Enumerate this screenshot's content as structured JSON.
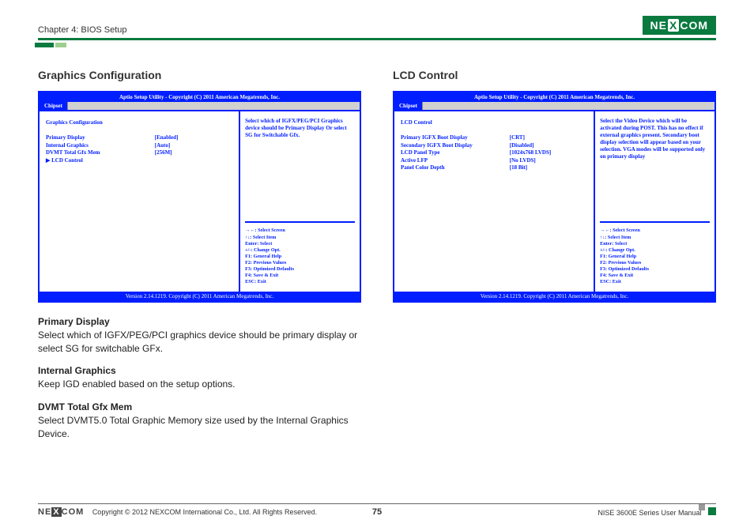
{
  "header": {
    "chapter": "Chapter 4: BIOS Setup",
    "brand": "NEXCOM"
  },
  "left": {
    "title": "Graphics Configuration",
    "bios": {
      "top": "Aptio Setup Utility - Copyright (C) 2011 American Megatrends, Inc.",
      "tab": "Chipset",
      "heading": "Graphics Configuration",
      "rows": [
        {
          "label": "Primary Display",
          "value": "[Enabled]"
        },
        {
          "label": "Internal Graphics",
          "value": "[Auto]"
        },
        {
          "label": "DVMT Total Gfx Mem",
          "value": "[256M]"
        },
        {
          "label": "▶ LCD Control",
          "value": ""
        }
      ],
      "help": "Select which of IGFX/PEG/PCI Graphics device should be Primary Display Or select SG for Switchable Gfx.",
      "keys": [
        "→←: Select Screen",
        "↑↓: Select Item",
        "Enter: Select",
        "+/-: Change Opt.",
        "F1: General Help",
        "F2: Previous Values",
        "F3: Optimized Defaults",
        "F4: Save & Exit",
        "ESC: Exit"
      ],
      "bottom": "Version 2.14.1219. Copyright (C) 2011 American Megatrends, Inc."
    },
    "descriptions": [
      {
        "term": "Primary Display",
        "body": "Select which of IGFX/PEG/PCI graphics device should be primary display or select SG for switchable GFx."
      },
      {
        "term": "Internal Graphics",
        "body": "Keep IGD enabled based on the setup options."
      },
      {
        "term": "DVMT Total Gfx Mem",
        "body": "Select DVMT5.0 Total Graphic Memory size used by the Internal Graphics Device."
      }
    ]
  },
  "right": {
    "title": "LCD Control",
    "bios": {
      "top": "Aptio Setup Utility - Copyright (C) 2011 American Megatrends, Inc.",
      "tab": "Chipset",
      "heading": "LCD Control",
      "rows": [
        {
          "label": "Primary IGFX Boot Display",
          "value": "[CRT]"
        },
        {
          "label": "Secondary IGFX Boot Display",
          "value": "[Disabled]"
        },
        {
          "label": "LCD Panel Type",
          "value": "[1024x768    LVDS]"
        },
        {
          "label": "Active LFP",
          "value": "[No LVDS]"
        },
        {
          "label": "Panel Color Depth",
          "value": "[18 Bit]"
        }
      ],
      "help": "Select the Video Device which will be activated during POST. This has no effect if external graphics present. Secondary boot display selection will appear based on your selection. VGA modes will be supported only on primary display",
      "keys": [
        "→←: Select Screen",
        "↑↓: Select Item",
        "Enter: Select",
        "+/-: Change Opt.",
        "F1: General Help",
        "F2: Previous Values",
        "F3: Optimized Defaults",
        "F4: Save & Exit",
        "ESC: Exit"
      ],
      "bottom": "Version 2.14.1219. Copyright (C) 2011 American Megatrends, Inc."
    }
  },
  "footer": {
    "brand": "NEXCOM",
    "copyright": "Copyright © 2012 NEXCOM International Co., Ltd. All Rights Reserved.",
    "page": "75",
    "manual": "NISE 3600E Series User Manual"
  }
}
